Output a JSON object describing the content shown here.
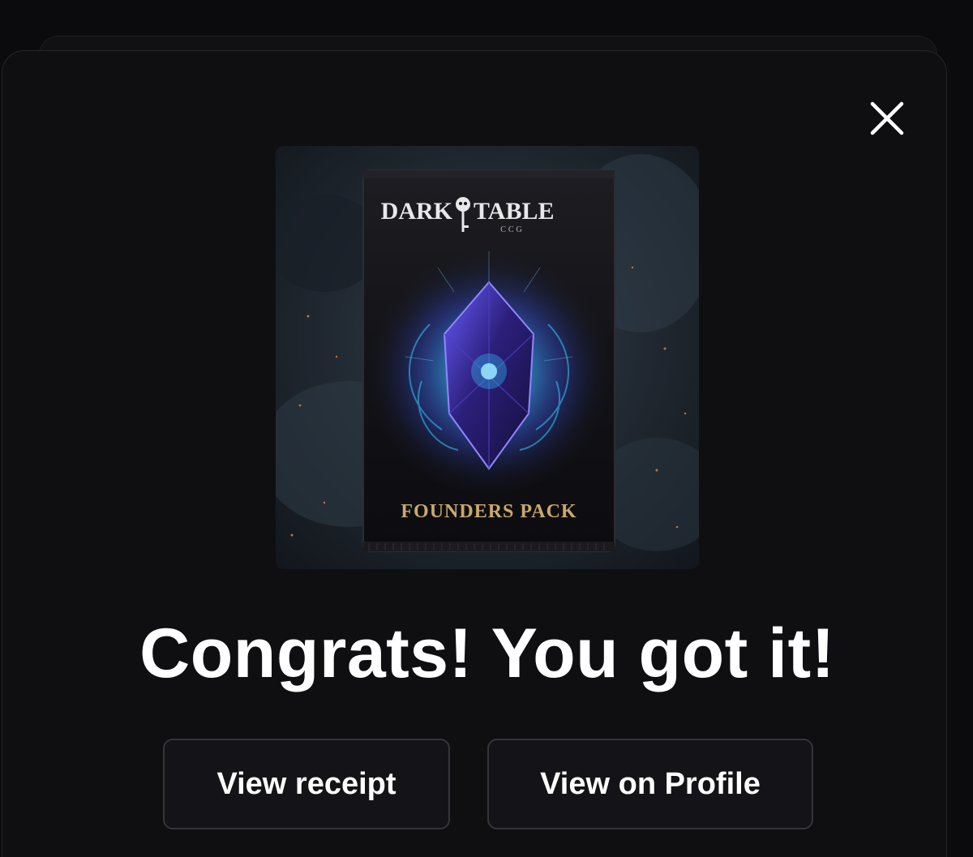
{
  "modal": {
    "title": "Congrats! You got it!",
    "close_icon": "close-icon"
  },
  "product_image": {
    "brand_left": "DARK",
    "brand_right": "TABLE",
    "brand_sub": "CCG",
    "pack_name": "FOUNDERS PACK",
    "accent_color": "#3d5cff",
    "glow_color": "#35c8ff",
    "gold_text_color": "#c9a96b"
  },
  "actions": {
    "view_receipt": "View receipt",
    "view_profile": "View on Profile"
  }
}
